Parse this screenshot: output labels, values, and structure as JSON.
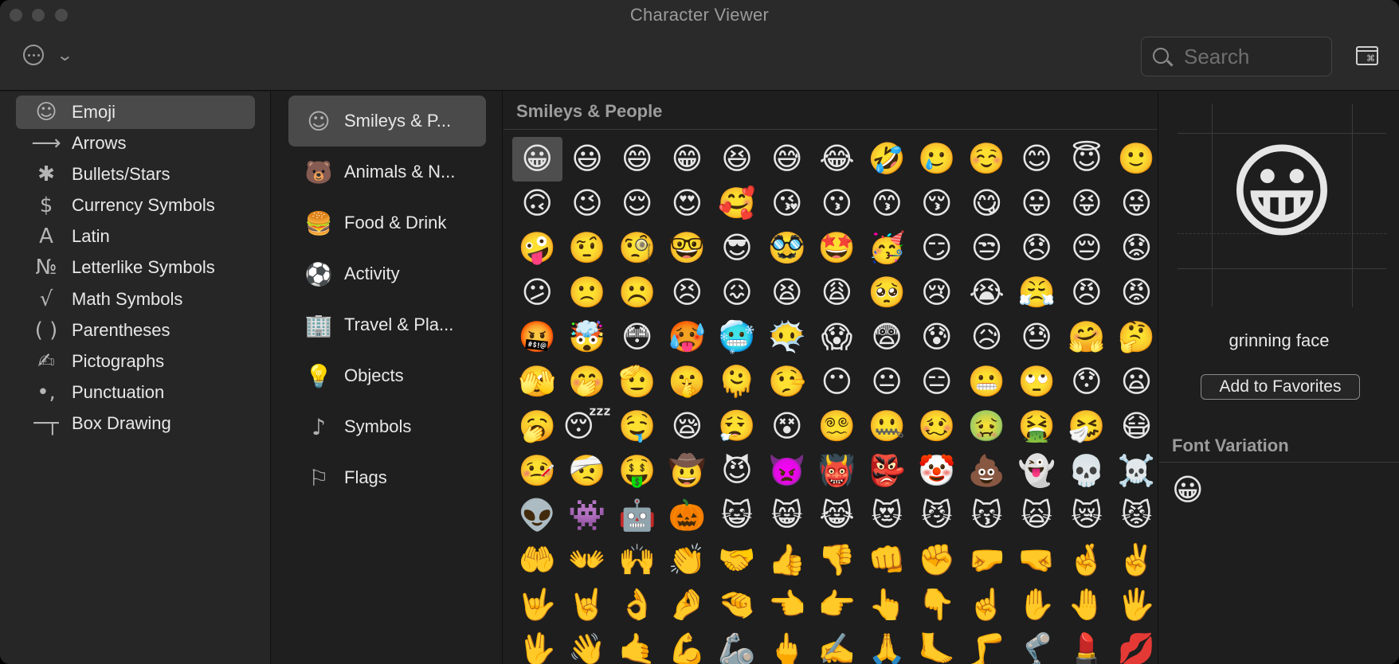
{
  "window": {
    "title": "Character Viewer"
  },
  "toolbar": {
    "search_placeholder": "Search"
  },
  "sidebar": {
    "items": [
      {
        "label": "Emoji",
        "icon": "☺",
        "icon_name": "smiley-icon",
        "selected": true
      },
      {
        "label": "Arrows",
        "icon": "⟶",
        "icon_name": "arrow-icon"
      },
      {
        "label": "Bullets/Stars",
        "icon": "✱",
        "icon_name": "asterisk-icon"
      },
      {
        "label": "Currency Symbols",
        "icon": "$",
        "icon_name": "dollar-icon"
      },
      {
        "label": "Latin",
        "icon": "A",
        "icon_name": "latin-a-icon"
      },
      {
        "label": "Letterlike Symbols",
        "icon": "№",
        "icon_name": "numero-icon"
      },
      {
        "label": "Math Symbols",
        "icon": "√",
        "icon_name": "square-root-icon"
      },
      {
        "label": "Parentheses",
        "icon": "( )",
        "icon_name": "parentheses-icon"
      },
      {
        "label": "Pictographs",
        "icon": "✍",
        "icon_name": "writing-hand-icon"
      },
      {
        "label": "Punctuation",
        "icon": "•,",
        "icon_name": "punctuation-icon"
      },
      {
        "label": "Box Drawing",
        "icon": "─┬",
        "icon_name": "box-drawing-icon"
      }
    ]
  },
  "categories": {
    "items": [
      {
        "label": "Smileys & P...",
        "icon": "☺",
        "icon_name": "smiley-icon",
        "selected": true
      },
      {
        "label": "Animals & N...",
        "icon": "🐻",
        "icon_name": "bear-icon"
      },
      {
        "label": "Food & Drink",
        "icon": "🍔",
        "icon_name": "burger-icon"
      },
      {
        "label": "Activity",
        "icon": "⚽",
        "icon_name": "soccer-ball-icon"
      },
      {
        "label": "Travel & Pla...",
        "icon": "🏢",
        "icon_name": "building-icon"
      },
      {
        "label": "Objects",
        "icon": "💡",
        "icon_name": "lightbulb-icon"
      },
      {
        "label": "Symbols",
        "icon": "♪",
        "icon_name": "symbols-icon"
      },
      {
        "label": "Flags",
        "icon": "⚐",
        "icon_name": "flag-icon"
      }
    ]
  },
  "grid": {
    "header": "Smileys & People",
    "selected_index": 0,
    "emojis": [
      "😀",
      "😃",
      "😄",
      "😁",
      "😆",
      "😅",
      "😂",
      "🤣",
      "🥲",
      "☺️",
      "😊",
      "😇",
      "🙂",
      "🙃",
      "😉",
      "😌",
      "😍",
      "🥰",
      "😘",
      "😗",
      "😙",
      "😚",
      "😋",
      "😛",
      "😝",
      "😜",
      "🤪",
      "🤨",
      "🧐",
      "🤓",
      "😎",
      "🥸",
      "🤩",
      "🥳",
      "😏",
      "😒",
      "😞",
      "😔",
      "😟",
      "😕",
      "🙁",
      "☹️",
      "😣",
      "😖",
      "😫",
      "😩",
      "🥺",
      "😢",
      "😭",
      "😤",
      "😠",
      "😡",
      "🤬",
      "🤯",
      "😳",
      "🥵",
      "🥶",
      "😶‍🌫️",
      "😱",
      "😨",
      "😰",
      "😥",
      "😓",
      "🤗",
      "🤔",
      "🫣",
      "🤭",
      "🫡",
      "🤫",
      "🫠",
      "🤥",
      "😶",
      "😐",
      "😑",
      "😬",
      "🙄",
      "😯",
      "😦",
      "🥱",
      "😴",
      "🤤",
      "😪",
      "😮‍💨",
      "😵",
      "😵‍💫",
      "🤐",
      "🥴",
      "🤢",
      "🤮",
      "🤧",
      "😷",
      "🤒",
      "🤕",
      "🤑",
      "🤠",
      "😈",
      "👿",
      "👹",
      "👺",
      "🤡",
      "💩",
      "👻",
      "💀",
      "☠️",
      "👽",
      "👾",
      "🤖",
      "🎃",
      "😺",
      "😸",
      "😹",
      "😻",
      "😼",
      "😽",
      "🙀",
      "😿",
      "😾",
      "🤲",
      "👐",
      "🙌",
      "👏",
      "🤝",
      "👍",
      "👎",
      "👊",
      "✊",
      "🤛",
      "🤜",
      "🤞",
      "✌️",
      "🤟",
      "🤘",
      "👌",
      "🤌",
      "🤏",
      "👈",
      "👉",
      "👆",
      "👇",
      "☝️",
      "✋",
      "🤚",
      "🖐️",
      "🖖",
      "👋",
      "🤙",
      "💪",
      "🦾",
      "🖕",
      "✍️",
      "🙏",
      "🦶",
      "🦵",
      "🦿",
      "💄",
      "💋"
    ]
  },
  "detail": {
    "glyph": "😀",
    "name": "grinning face",
    "add_to_favorites": "Add to Favorites",
    "font_variation_header": "Font Variation",
    "font_variation_glyph": "😀"
  }
}
